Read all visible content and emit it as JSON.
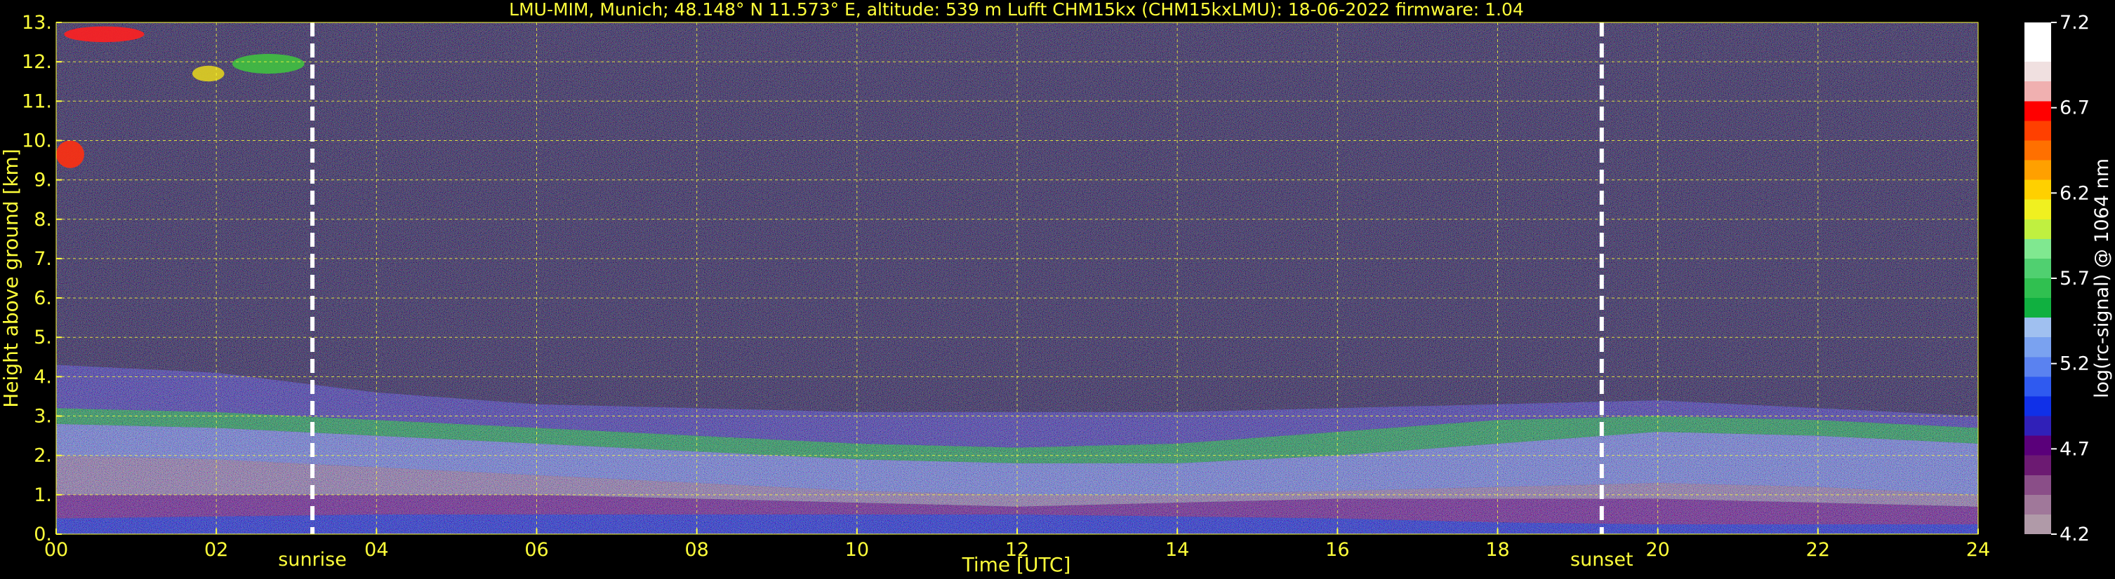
{
  "chart_data": {
    "type": "heatmap",
    "title": "LMU-MIM, Munich; 48.148° N 11.573° E, altitude: 539 m    Lufft CHM15kx (CHM15kxLMU): 18-06-2022    firmware: 1.04",
    "xlabel": "Time [UTC]",
    "ylabel": "Height above ground [km]",
    "xlim": [
      0,
      24
    ],
    "ylim": [
      0,
      13
    ],
    "x_ticks": [
      "00",
      "02",
      "04",
      "06",
      "08",
      "10",
      "12",
      "14",
      "16",
      "18",
      "20",
      "22",
      "24"
    ],
    "y_ticks": [
      "0.",
      "1.",
      "2.",
      "3.",
      "4.",
      "5.",
      "6.",
      "7.",
      "8.",
      "9.",
      "10.",
      "11.",
      "12.",
      "13."
    ],
    "grid": true,
    "markers": [
      {
        "label": "sunrise",
        "x": 3.2
      },
      {
        "label": "sunset",
        "x": 19.3
      }
    ],
    "colorbar": {
      "label": "log(rc-signal) @ 1064 nm",
      "min": 4.2,
      "max": 7.2,
      "ticks": [
        "4.2",
        "4.7",
        "5.2",
        "5.7",
        "6.2",
        "6.7",
        "7.2"
      ],
      "colors": [
        "#b09aa8",
        "#a0789a",
        "#8a4e88",
        "#6c1a72",
        "#5a007a",
        "#3020b8",
        "#1030e8",
        "#2f5af0",
        "#5a82f0",
        "#7aa2f0",
        "#a0c0f0",
        "#10b040",
        "#30c050",
        "#50d070",
        "#80e890",
        "#c0f040",
        "#f0f020",
        "#ffd000",
        "#ffa000",
        "#ff7000",
        "#ff4000",
        "#ff0000",
        "#f0b0b0",
        "#f0e0e0",
        "#ffffff",
        "#ffffff"
      ]
    },
    "layers": [
      {
        "t": [
          0,
          2,
          4,
          6,
          8,
          10,
          12,
          14,
          16,
          18,
          20,
          22,
          24
        ],
        "h_bottom": [
          0.0,
          0.0,
          0.0,
          0.0,
          0.0,
          0.0,
          0.0,
          0.0,
          0.0,
          0.0,
          0.0,
          0.0,
          0.0
        ],
        "h_top": [
          0.4,
          0.45,
          0.5,
          0.5,
          0.5,
          0.5,
          0.5,
          0.45,
          0.4,
          0.3,
          0.25,
          0.25,
          0.25
        ],
        "color": "#1a2ad8"
      },
      {
        "t": [
          0,
          2,
          4,
          6,
          8,
          10,
          12,
          14,
          16,
          18,
          20,
          22,
          24
        ],
        "h_bottom": [
          0.4,
          0.45,
          0.5,
          0.5,
          0.5,
          0.5,
          0.5,
          0.45,
          0.4,
          0.3,
          0.25,
          0.25,
          0.25
        ],
        "h_top": [
          1.0,
          1.0,
          1.0,
          1.0,
          0.9,
          0.8,
          0.7,
          0.8,
          0.9,
          0.9,
          0.9,
          0.8,
          0.7
        ],
        "color": "#7a1a86"
      },
      {
        "t": [
          0,
          2,
          4,
          6,
          8,
          10,
          12,
          14,
          16,
          18,
          20,
          22,
          24
        ],
        "h_bottom": [
          1.0,
          1.0,
          1.0,
          1.0,
          0.9,
          0.8,
          0.7,
          0.8,
          0.9,
          0.9,
          0.9,
          0.8,
          0.7
        ],
        "h_top": [
          2.0,
          1.9,
          1.7,
          1.5,
          1.3,
          1.1,
          1.0,
          1.0,
          1.1,
          1.2,
          1.3,
          1.2,
          1.0
        ],
        "color": "#a88aa8"
      },
      {
        "t": [
          0,
          2,
          4,
          6,
          8,
          10,
          12,
          14,
          16,
          18,
          20,
          22,
          24
        ],
        "h_bottom": [
          2.0,
          1.9,
          1.7,
          1.5,
          1.3,
          1.1,
          1.0,
          1.0,
          1.1,
          1.2,
          1.3,
          1.2,
          1.0
        ],
        "h_top": [
          2.8,
          2.7,
          2.5,
          2.3,
          2.1,
          1.9,
          1.8,
          1.8,
          2.0,
          2.3,
          2.6,
          2.5,
          2.3
        ],
        "color": "#8090e0"
      },
      {
        "t": [
          0,
          2,
          4,
          6,
          8,
          10,
          12,
          14,
          16,
          18,
          20,
          22,
          24
        ],
        "h_bottom": [
          2.8,
          2.7,
          2.5,
          2.3,
          2.1,
          1.9,
          1.8,
          1.8,
          2.0,
          2.3,
          2.6,
          2.5,
          2.3
        ],
        "h_top": [
          3.2,
          3.1,
          2.9,
          2.7,
          2.5,
          2.3,
          2.2,
          2.3,
          2.6,
          2.9,
          3.0,
          2.9,
          2.7
        ],
        "color": "#20b040"
      },
      {
        "t": [
          0,
          2,
          4,
          6,
          8,
          10,
          12,
          14,
          16,
          18,
          20,
          22,
          24
        ],
        "h_bottom": [
          3.2,
          3.1,
          2.9,
          2.7,
          2.5,
          2.3,
          2.2,
          2.3,
          2.6,
          2.9,
          3.0,
          2.9,
          2.7
        ],
        "h_top": [
          4.3,
          4.1,
          3.6,
          3.3,
          3.2,
          3.1,
          3.1,
          3.1,
          3.2,
          3.3,
          3.4,
          3.2,
          3.0
        ],
        "color": "#4a3aa8"
      }
    ],
    "clouds": [
      {
        "t_start": 0.1,
        "t_end": 1.1,
        "h_bottom": 12.5,
        "h_top": 12.9,
        "color": "#ff2020"
      },
      {
        "t_start": 1.7,
        "t_end": 2.1,
        "h_bottom": 11.5,
        "h_top": 11.9,
        "color": "#e0d020"
      },
      {
        "t_start": 2.2,
        "t_end": 3.1,
        "h_bottom": 11.7,
        "h_top": 12.2,
        "color": "#40c040"
      },
      {
        "t_start": 0.0,
        "t_end": 0.35,
        "h_bottom": 9.3,
        "h_top": 10.0,
        "color": "#ff3010"
      }
    ]
  }
}
